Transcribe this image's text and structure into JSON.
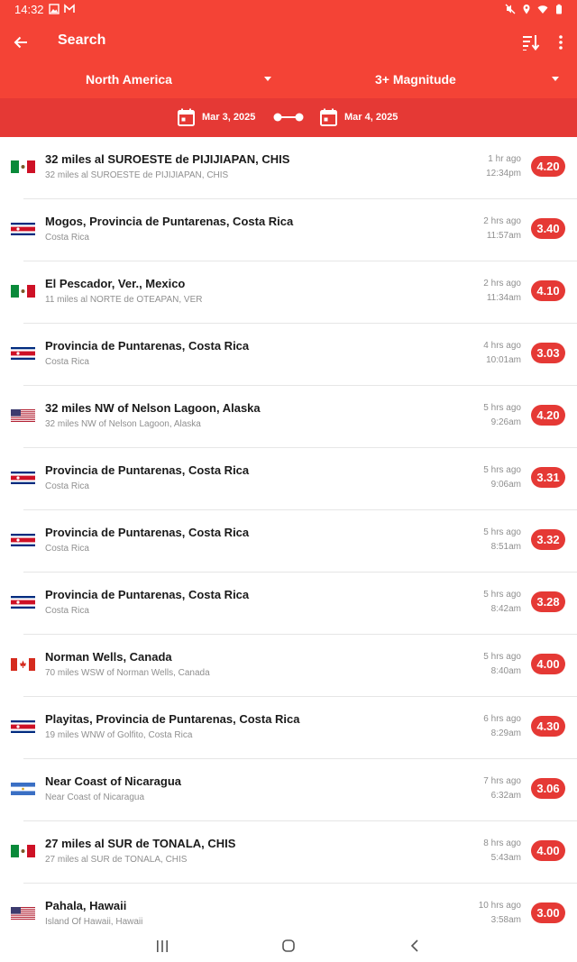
{
  "status_bar": {
    "time": "14:32",
    "left_icons": [
      "image-icon",
      "gmail-icon"
    ],
    "right_icons": [
      "mute-icon",
      "location-icon",
      "wifi-icon",
      "battery-icon"
    ]
  },
  "toolbar": {
    "title": "Search",
    "back_icon": "arrow-back-icon",
    "sort_icon": "sort-icon",
    "more_icon": "more-vert-icon"
  },
  "filters": {
    "region": "North America",
    "magnitude": "3+ Magnitude"
  },
  "date_range": {
    "start": "Mar 3, 2025",
    "end": "Mar 4, 2025"
  },
  "colors": {
    "header": "#f44336",
    "datebar": "#e53935",
    "badge": "#e53935"
  },
  "quakes": [
    {
      "flag": "mexico",
      "place": "32 miles al SUROESTE de  PIJIJIAPAN, CHIS",
      "detail": "32 miles al SUROESTE de  PIJIJIAPAN, CHIS",
      "ago": "1 hr ago",
      "time": "12:34pm",
      "mag": "4.20"
    },
    {
      "flag": "costa-rica",
      "place": "Mogos, Provincia de Puntarenas, Costa Rica",
      "detail": "Costa Rica",
      "ago": "2 hrs ago",
      "time": "11:57am",
      "mag": "3.40"
    },
    {
      "flag": "mexico",
      "place": "El Pescador, Ver., Mexico",
      "detail": "11 miles al NORTE de  OTEAPAN, VER",
      "ago": "2 hrs ago",
      "time": "11:34am",
      "mag": "4.10"
    },
    {
      "flag": "costa-rica",
      "place": "Provincia de Puntarenas, Costa Rica",
      "detail": "Costa Rica",
      "ago": "4 hrs ago",
      "time": "10:01am",
      "mag": "3.03"
    },
    {
      "flag": "usa",
      "place": "32 miles NW of Nelson Lagoon, Alaska",
      "detail": "32 miles NW of Nelson Lagoon, Alaska",
      "ago": "5 hrs ago",
      "time": "9:26am",
      "mag": "4.20"
    },
    {
      "flag": "costa-rica",
      "place": "Provincia de Puntarenas, Costa Rica",
      "detail": "Costa Rica",
      "ago": "5 hrs ago",
      "time": "9:06am",
      "mag": "3.31"
    },
    {
      "flag": "costa-rica",
      "place": "Provincia de Puntarenas, Costa Rica",
      "detail": "Costa Rica",
      "ago": "5 hrs ago",
      "time": "8:51am",
      "mag": "3.32"
    },
    {
      "flag": "costa-rica",
      "place": "Provincia de Puntarenas, Costa Rica",
      "detail": "Costa Rica",
      "ago": "5 hrs ago",
      "time": "8:42am",
      "mag": "3.28"
    },
    {
      "flag": "canada",
      "place": "Norman Wells, Canada",
      "detail": "70 miles WSW of Norman Wells, Canada",
      "ago": "5 hrs ago",
      "time": "8:40am",
      "mag": "4.00"
    },
    {
      "flag": "costa-rica",
      "place": "Playitas, Provincia de Puntarenas, Costa Rica",
      "detail": "19 miles WNW of Golfito, Costa Rica",
      "ago": "6 hrs ago",
      "time": "8:29am",
      "mag": "4.30"
    },
    {
      "flag": "nicaragua",
      "place": "Near Coast of Nicaragua",
      "detail": "Near Coast of Nicaragua",
      "ago": "7 hrs ago",
      "time": "6:32am",
      "mag": "3.06"
    },
    {
      "flag": "mexico",
      "place": "27 miles al SUR de  TONALA, CHIS",
      "detail": "27 miles al SUR de  TONALA, CHIS",
      "ago": "8 hrs ago",
      "time": "5:43am",
      "mag": "4.00"
    },
    {
      "flag": "usa",
      "place": "Pahala, Hawaii",
      "detail": "Island Of Hawaii, Hawaii",
      "ago": "10 hrs ago",
      "time": "3:58am",
      "mag": "3.00"
    }
  ],
  "nav_bar": {
    "icons": [
      "recent-apps-icon",
      "home-icon",
      "back-nav-icon"
    ]
  }
}
